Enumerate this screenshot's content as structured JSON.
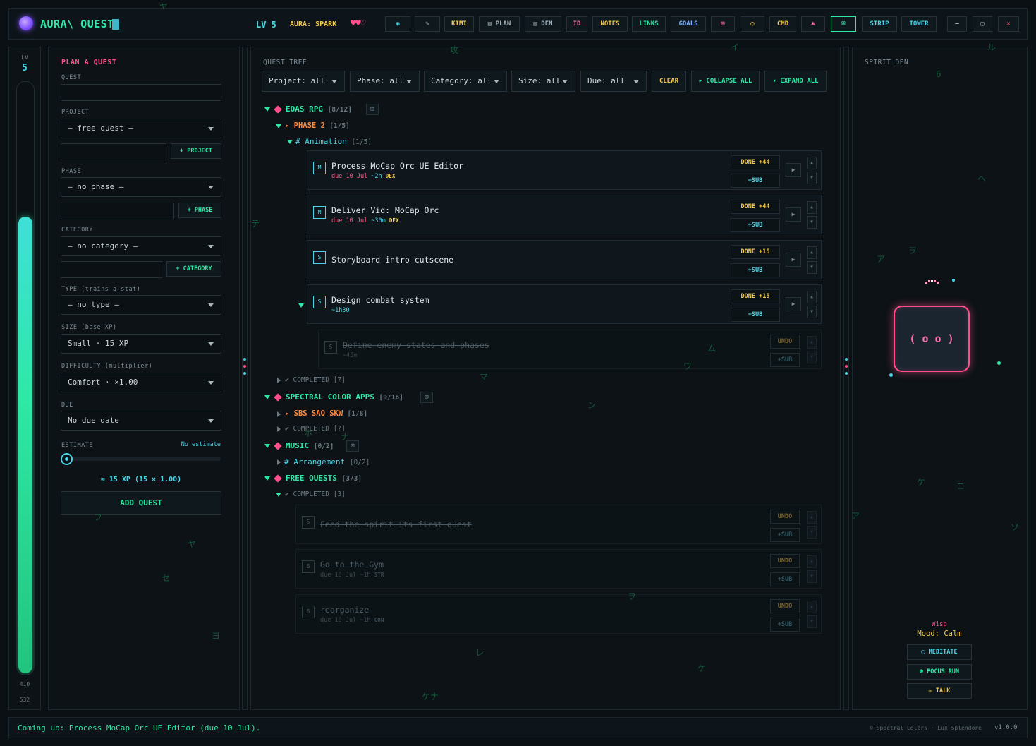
{
  "header": {
    "title": "AURA\\ QUEST",
    "level": "LV 5",
    "aura": "AURA: SPARK",
    "hearts": "♥♥♡",
    "buttons": [
      {
        "label": "◉",
        "icon": "eye-icon"
      },
      {
        "label": "✎",
        "icon": "wrench-icon"
      },
      {
        "label": "KIMI"
      },
      {
        "label": "▤ PLAN"
      },
      {
        "label": "▤ DEN"
      },
      {
        "label": "ID"
      },
      {
        "label": "NOTES"
      },
      {
        "label": "LINKS"
      },
      {
        "label": "GOALS"
      },
      {
        "label": "⊞",
        "icon": "gift-icon"
      },
      {
        "label": "○",
        "icon": "circle-icon"
      },
      {
        "label": "CMD"
      },
      {
        "label": "✱",
        "icon": "puzzle-icon"
      },
      {
        "label": "⌘",
        "icon": "command-icon"
      },
      {
        "label": "STRIP"
      },
      {
        "label": "TOWER"
      }
    ],
    "window_controls": [
      "–",
      "▢",
      "✕"
    ]
  },
  "level_strip": {
    "label": "LV",
    "level": "5",
    "xp_current": "410",
    "xp_sep": "—",
    "xp_total": "532",
    "progress": 0.77
  },
  "plan": {
    "title": "PLAN A QUEST",
    "quest_label": "QUEST",
    "quest_value": "",
    "project_label": "PROJECT",
    "project_value": "— free quest —",
    "project_add": "+ PROJECT",
    "phase_label": "PHASE",
    "phase_value": "— no phase —",
    "phase_add": "+ PHASE",
    "category_label": "CATEGORY",
    "category_value": "— no category —",
    "category_add": "+ CATEGORY",
    "type_label": "TYPE  (trains a stat)",
    "type_value": "— no type —",
    "size_label": "SIZE  (base XP)",
    "size_value": "Small  ·  15 XP",
    "difficulty_label": "DIFFICULTY  (multiplier)",
    "difficulty_value": "Comfort  ·  ×1.00",
    "due_label": "DUE",
    "due_value": "No due date",
    "estimate_label": "ESTIMATE",
    "estimate_value": "No estimate",
    "estimate_slider": 0,
    "xp_summary": "≈ 15 XP  (15 × 1.00)",
    "add_button": "ADD QUEST"
  },
  "tree": {
    "title": "QUEST TREE",
    "filters": [
      "Project: all",
      "Phase: all",
      "Category: all",
      "Size: all",
      "Due: all"
    ],
    "clear": "CLEAR",
    "collapse": "▸ COLLAPSE ALL",
    "expand": "▾ EXPAND ALL",
    "projects": [
      {
        "name": "EOAS RPG",
        "count": "[8/12]"
      },
      {
        "name": "SPECTRAL COLOR APPS",
        "count": "[9/16]"
      },
      {
        "name": "MUSIC",
        "count": "[0/2]"
      },
      {
        "name": "FREE QUESTS",
        "count": "[3/3]"
      }
    ],
    "phase2": {
      "name": "▸ PHASE 2",
      "count": "[1/5]"
    },
    "animation": {
      "name": "# Animation",
      "count": "[1/5]"
    },
    "completed_eoas": {
      "label": "COMPLETED",
      "count": "[7]"
    },
    "sbs": {
      "name": "▸ SBS SAQ SKW",
      "count": "[1/8]"
    },
    "completed_spectral": {
      "label": "COMPLETED",
      "count": "[7]"
    },
    "arrangement": {
      "name": "# Arrangement",
      "count": "[0/2]"
    },
    "completed_free": {
      "label": "COMPLETED",
      "count": "[3]"
    },
    "quests": [
      {
        "badge": "M",
        "title": "Process MoCap Orc UE Editor",
        "due": "due 10 Jul",
        "est": "~2h",
        "stat": "DEX",
        "done": "DONE +44",
        "sub": "+SUB"
      },
      {
        "badge": "M",
        "title": "Deliver Vid: MoCap Orc",
        "due": "due 10 Jul",
        "est": "~30m",
        "stat": "DEX",
        "done": "DONE +44",
        "sub": "+SUB"
      },
      {
        "badge": "S",
        "title": "Storyboard intro cutscene",
        "due": "",
        "est": "",
        "stat": "",
        "done": "DONE +15",
        "sub": "+SUB"
      },
      {
        "badge": "S",
        "title": "Design combat system",
        "due": "",
        "est": "~1h30",
        "stat": "",
        "done": "DONE +15",
        "sub": "+SUB"
      }
    ],
    "subquest": {
      "badge": "S",
      "title": "Define enemy states and phases",
      "est": "~45m",
      "undo": "UNDO",
      "sub": "+SUB"
    },
    "completed_quests": [
      {
        "badge": "S",
        "title": "Feed the spirit its first quest",
        "due": "",
        "est": "",
        "stat": "",
        "undo": "UNDO",
        "sub": "+SUB"
      },
      {
        "badge": "S",
        "title": "Go to the Gym",
        "due": "due 10 Jul",
        "est": "~1h",
        "stat": "STR",
        "undo": "UNDO",
        "sub": "+SUB"
      },
      {
        "badge": "S",
        "title": "reorganize",
        "due": "due 10 Jul",
        "est": "~1h",
        "stat": "CON",
        "undo": "UNDO",
        "sub": "+SUB"
      }
    ]
  },
  "den": {
    "title": "SPIRIT DEN",
    "face": "( o  o )",
    "spirit_name": "Wisp",
    "mood": "Mood: Calm",
    "buttons": [
      {
        "label": "MEDITATE",
        "icon": "circle-icon"
      },
      {
        "label": "FOCUS RUN",
        "icon": "runner-icon"
      },
      {
        "label": "TALK",
        "icon": "chat-icon"
      }
    ]
  },
  "footer": {
    "message": "Coming up: Process MoCap Orc UE Editor (due 10 Jul).",
    "credit": "© Spectral Colors · Lux Splendore",
    "version": "v1.0.0"
  },
  "colors": {
    "accent": "#2ee8a6",
    "pink": "#ff4f8a",
    "cyan": "#49d6e8",
    "gold": "#f2c94c"
  }
}
